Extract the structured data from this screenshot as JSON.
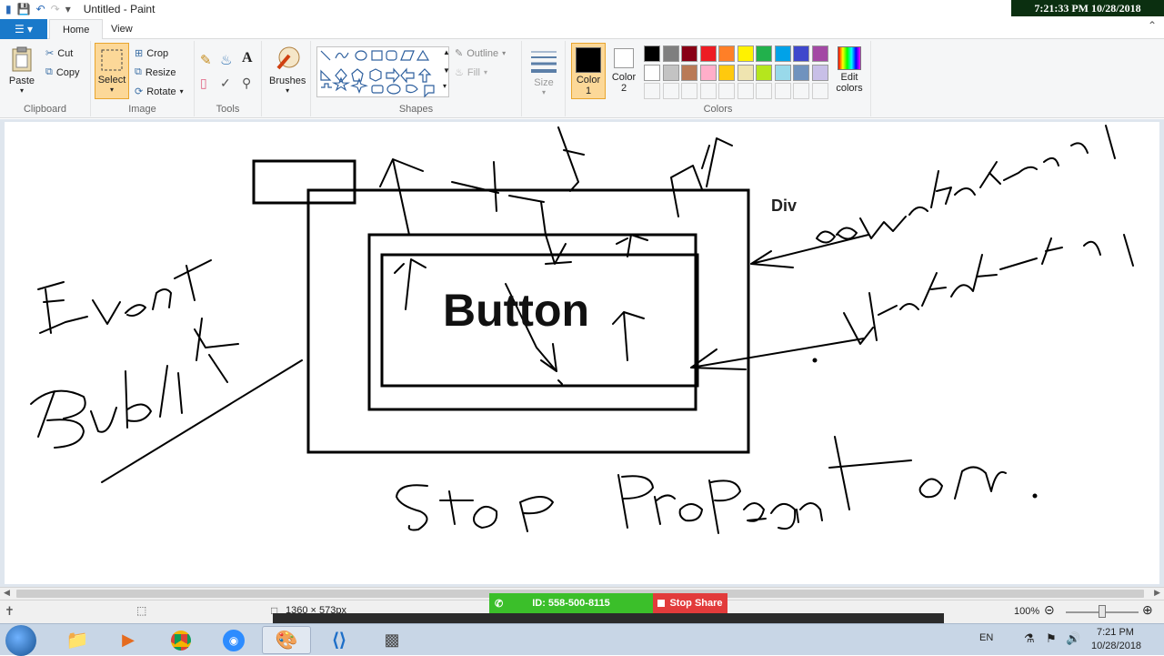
{
  "window": {
    "title": "Untitled - Paint"
  },
  "clock_overlay": "7:21:33 PM 10/28/2018",
  "tabs": {
    "file": "☰ ▾",
    "home": "Home",
    "view": "View"
  },
  "clipboard": {
    "paste": "Paste",
    "cut": "Cut",
    "copy": "Copy",
    "label": "Clipboard"
  },
  "image": {
    "select": "Select",
    "crop": "Crop",
    "resize": "Resize",
    "rotate": "Rotate",
    "label": "Image"
  },
  "tools": {
    "label": "Tools"
  },
  "brushes": {
    "label": "Brushes"
  },
  "shapes": {
    "outline": "Outline",
    "fill": "Fill",
    "label": "Shapes"
  },
  "size": {
    "label": "Size"
  },
  "colors": {
    "color1": "Color 1",
    "color2": "Color 2",
    "edit": "Edit colors",
    "label": "Colors",
    "palette_row1": [
      "#000000",
      "#7f7f7f",
      "#880015",
      "#ed1c24",
      "#ff7f27",
      "#fff200",
      "#22b14c",
      "#00a2e8",
      "#3f48cc",
      "#a349a4"
    ],
    "palette_row2": [
      "#ffffff",
      "#c3c3c3",
      "#b97a57",
      "#ffaec9",
      "#ffc90e",
      "#efe4b0",
      "#b5e61d",
      "#99d9ea",
      "#7092be",
      "#c8bfe7"
    ]
  },
  "canvas": {
    "div_label": "Div",
    "button_label": "Button"
  },
  "status": {
    "dimensions": "1360 × 573px",
    "zoom": "100%"
  },
  "share": {
    "id": "ID: 558-500-8115",
    "stop": "Stop Share"
  },
  "taskbar": {
    "lang": "EN",
    "time": "7:21 PM",
    "date": "10/28/2018"
  }
}
